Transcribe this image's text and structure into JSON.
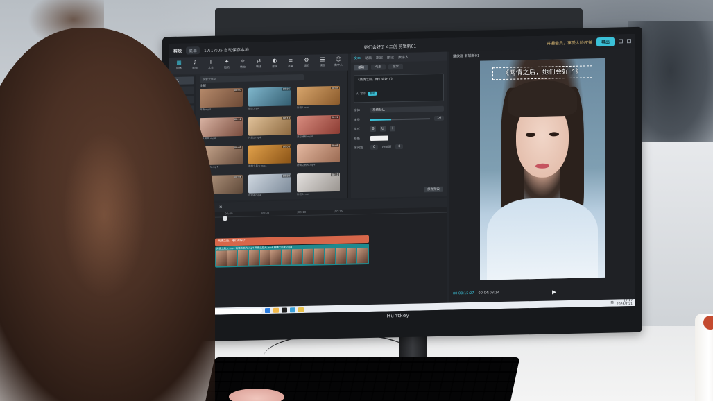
{
  "scene": {
    "description_colors": {
      "accent": "#3bc1d8",
      "text_track": "#d7674a",
      "video_track": "#1f8a8f"
    },
    "monitor_brand": "Huntkey"
  },
  "app": {
    "logo": "剪映",
    "menu": "菜单",
    "autosave": "17:17:05 自动保存本地",
    "project": "她们会好了 4二创 剪辑新01",
    "vip": "开通会员，享受人脸权益",
    "export": "导出",
    "toolbar": [
      {
        "icon": "▦",
        "label": "媒体"
      },
      {
        "icon": "♪",
        "label": "音频"
      },
      {
        "icon": "T",
        "label": "文本"
      },
      {
        "icon": "✦",
        "label": "贴纸"
      },
      {
        "icon": "✧",
        "label": "特效"
      },
      {
        "icon": "⇄",
        "label": "转场"
      },
      {
        "icon": "◐",
        "label": "滤镜"
      },
      {
        "icon": "≡",
        "label": "字幕"
      },
      {
        "icon": "⚙",
        "label": "调节"
      },
      {
        "icon": "☰",
        "label": "模板"
      },
      {
        "icon": "☺",
        "label": "数字人"
      }
    ],
    "side_categories": [
      "导入",
      "我的",
      "云素材",
      "素材库",
      "AI生成"
    ],
    "search_placeholder": "搜索文件名",
    "media_label": "全部",
    "media": [
      {
        "name": "开场.mp4",
        "duration": "00:07"
      },
      {
        "name": "镜头.mp4",
        "duration": "00:06"
      },
      {
        "name": "片段1.mp4",
        "duration": "00:05"
      },
      {
        "name": "女人都想.mp4",
        "duration": "00:12"
      },
      {
        "name": "片段2.mp4",
        "duration": "00:10"
      },
      {
        "name": "我已经有.mp4",
        "duration": "00:28"
      },
      {
        "name": "两情之后大.mp4",
        "duration": "00:05"
      },
      {
        "name": "两情之后大.mp4",
        "duration": "00:08"
      },
      {
        "name": "两情之后大.mp4",
        "duration": "00:09"
      },
      {
        "name": "片段3.mp4",
        "duration": "00:06"
      },
      {
        "name": "片段4.mp4",
        "duration": "00:04"
      },
      {
        "name": "片段5.mp4",
        "duration": "00:11"
      }
    ]
  },
  "text_panel": {
    "tabs": [
      "文本",
      "动画",
      "跟踪",
      "朗读",
      "数字人"
    ],
    "subtabs": [
      "基础",
      "气泡",
      "花字"
    ],
    "content": "《两情之后，她们会好了》",
    "ai_write": "AI 写作",
    "ai_tag": "智能",
    "font_label": "字体",
    "font_value": "系统默认",
    "size_label": "字号",
    "size_value": "14",
    "style_label": "样式",
    "style_buttons": [
      "B",
      "U",
      "I"
    ],
    "color_label": "颜色",
    "spacing_label": "字间距",
    "spacing_value": "0",
    "line_label": "行间距",
    "line_value": "0",
    "reset": "保存预设",
    "size_fraction": 0.35
  },
  "player": {
    "title": "播放器-剪辑新01",
    "caption": "《两情之后，她们会好了》",
    "current_time": "00:00:15:27",
    "total_time": "00:04:08:14",
    "play_icon": "▶"
  },
  "timeline": {
    "tools": [
      "↶",
      "↷",
      "✂",
      "⇆",
      "◫",
      "✕"
    ],
    "ruler": [
      "00:00",
      "|00:05",
      "|00:10",
      "|00:15"
    ],
    "text_clip": "两情之后，她们会好了",
    "video_clip_labels": "两情之后大.mp4   两情之后大.mp4   两情之后大.mp4   两情之后大.mp4"
  },
  "taskbar": {
    "search": "搜索",
    "ime": "英",
    "time": "17:17",
    "date": "2026/7/21"
  }
}
